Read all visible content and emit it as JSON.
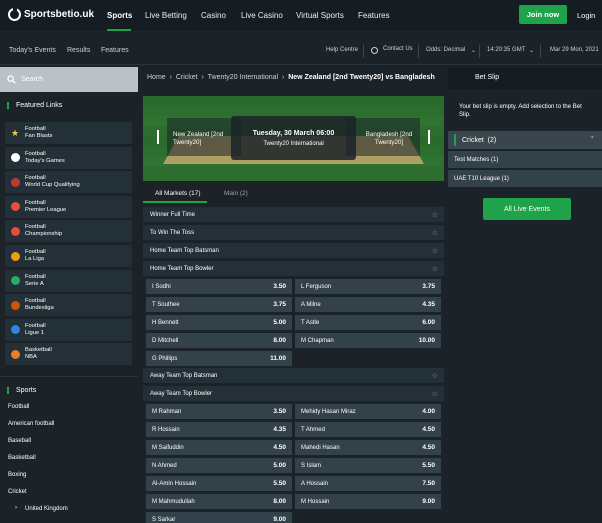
{
  "brand": {
    "name": "Sportsbetio.uk"
  },
  "topnav": {
    "items": [
      "Sports",
      "Live Betting",
      "Casino",
      "Live Casino",
      "Virtual Sports",
      "Features"
    ],
    "join": "Join now",
    "login": "Login"
  },
  "subbar": {
    "left": [
      "Today's Events",
      "Results",
      "Features"
    ],
    "help": "Help Centre",
    "contact": "Contact Us",
    "odds": "Odds:  Decimal",
    "time": "14:20:35  GMT",
    "date": "Mar 29 Mon, 2021"
  },
  "sidebar": {
    "search": "Search",
    "featured_title": "Featured Links",
    "featured": [
      {
        "line1": "Football",
        "line2": "Fan Blasts",
        "icon": "star-icon",
        "color": "#f2c94c"
      },
      {
        "line1": "Football",
        "line2": "Today's Games",
        "icon": "football-icon",
        "color": "#ffffff"
      },
      {
        "line1": "Football",
        "line2": "World Cup Qualifying",
        "icon": "trophy-icon",
        "color": "#c0392b"
      },
      {
        "line1": "Football",
        "line2": "Premier League",
        "icon": "england-flag-icon",
        "color": "#e74c3c"
      },
      {
        "line1": "Football",
        "line2": "Championship",
        "icon": "england-flag-icon",
        "color": "#e74c3c"
      },
      {
        "line1": "Football",
        "line2": "La Liga",
        "icon": "spain-flag-icon",
        "color": "#f39c12"
      },
      {
        "line1": "Football",
        "line2": "Serie A",
        "icon": "italy-flag-icon",
        "color": "#27ae60"
      },
      {
        "line1": "Football",
        "line2": "Bundesliga",
        "icon": "germany-flag-icon",
        "color": "#d35400"
      },
      {
        "line1": "Football",
        "line2": "Ligue 1",
        "icon": "france-flag-icon",
        "color": "#2e86de"
      },
      {
        "line1": "Basketball",
        "line2": "NBA",
        "icon": "basketball-icon",
        "color": "#e67e22"
      }
    ],
    "sports_title": "Sports",
    "sports": [
      "Football",
      "American football",
      "Baseball",
      "Basketball",
      "Boxing",
      "Cricket"
    ],
    "sub_sport": "United Kingdom"
  },
  "breadcrumb": [
    "Home",
    "Cricket",
    "Twenty20 International",
    "New Zealand [2nd Twenty20] vs Bangladesh"
  ],
  "match": {
    "home": "New Zealand [2nd Twenty20]",
    "away": "Bangladesh [2nd Twenty20]",
    "datetime": "Tuesday, 30 March 06:00",
    "competition": "Twenty20 International"
  },
  "tabs": {
    "all": "All Markets (17)",
    "main": "Main (2)"
  },
  "markets": {
    "winner": "Winner Full Time",
    "toss": "To Win The Toss",
    "home_bat": "Home Team Top Batsman",
    "home_bowl": "Home Team Top Bowler",
    "home_bowl_odds": [
      {
        "name": "I Sodhi",
        "price": "3.50"
      },
      {
        "name": "L Ferguson",
        "price": "3.75"
      },
      {
        "name": "T Southee",
        "price": "3.75"
      },
      {
        "name": "A Milne",
        "price": "4.35"
      },
      {
        "name": "H Bennett",
        "price": "5.00"
      },
      {
        "name": "T Astle",
        "price": "6.00"
      },
      {
        "name": "D Mitchell",
        "price": "8.00"
      },
      {
        "name": "M Chapman",
        "price": "10.00"
      },
      {
        "name": "G Phillips",
        "price": "11.00"
      }
    ],
    "away_bat": "Away Team Top Batsman",
    "away_bowl": "Away Team Top Bowler",
    "away_bowl_odds": [
      {
        "name": "M Rahman",
        "price": "3.50"
      },
      {
        "name": "Mehidy Hasan Miraz",
        "price": "4.00"
      },
      {
        "name": "R Hossain",
        "price": "4.35"
      },
      {
        "name": "T Ahmed",
        "price": "4.50"
      },
      {
        "name": "M Saifuddin",
        "price": "4.50"
      },
      {
        "name": "Mahedi Hasan",
        "price": "4.50"
      },
      {
        "name": "N Ahmed",
        "price": "5.00"
      },
      {
        "name": "S Islam",
        "price": "5.50"
      },
      {
        "name": "Al-Amin Hossain",
        "price": "5.50"
      },
      {
        "name": "A Hossain",
        "price": "7.50"
      },
      {
        "name": "M Mahmudullah",
        "price": "8.00"
      },
      {
        "name": "M Hossain",
        "price": "9.00"
      },
      {
        "name": "S Sarkar",
        "price": "9.00"
      }
    ]
  },
  "betslip": {
    "title": "Bet Slip",
    "message": "Your bet slip is empty. Add selection to the Bet Slip.",
    "cricket": "Cricket",
    "cricket_count": "(2)",
    "competitions": [
      "Test Matches (1)",
      "UAE T10 League (1)"
    ],
    "live_events": "All Live Events"
  }
}
